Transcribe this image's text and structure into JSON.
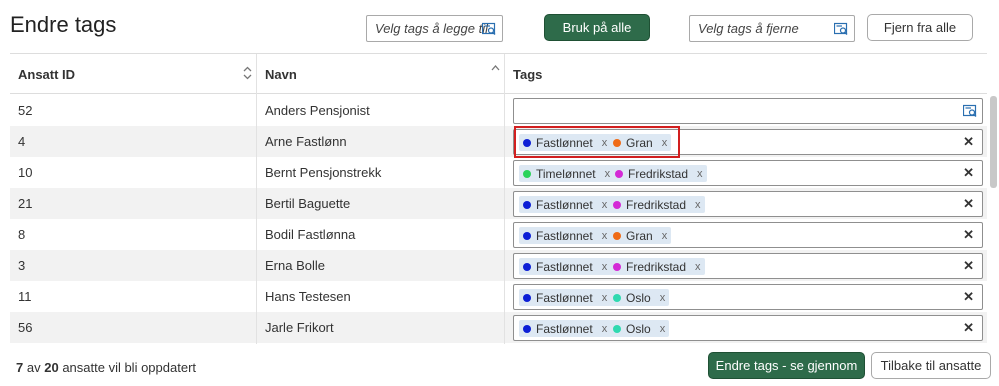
{
  "page": {
    "title": "Endre tags"
  },
  "toolbar": {
    "add_placeholder": "Velg tags å legge til",
    "apply_all": "Bruk på alle",
    "remove_placeholder": "Velg tags å fjerne",
    "remove_all": "Fjern fra alle"
  },
  "table": {
    "columns": {
      "id": "Ansatt ID",
      "name": "Navn",
      "tags": "Tags"
    },
    "rows": [
      {
        "id": "52",
        "name": "Anders Pensjonist",
        "tags": []
      },
      {
        "id": "4",
        "name": "Arne Fastlønn",
        "tags": [
          {
            "label": "Fastlønnet",
            "color": "#0d1fd6"
          },
          {
            "label": "Gran",
            "color": "#ef6b17"
          }
        ]
      },
      {
        "id": "10",
        "name": "Bernt Pensjonstrekk",
        "tags": [
          {
            "label": "Timelønnet",
            "color": "#2bd35a"
          },
          {
            "label": "Fredrikstad",
            "color": "#d42ad6"
          }
        ]
      },
      {
        "id": "21",
        "name": "Bertil Baguette",
        "tags": [
          {
            "label": "Fastlønnet",
            "color": "#0d1fd6"
          },
          {
            "label": "Fredrikstad",
            "color": "#d42ad6"
          }
        ]
      },
      {
        "id": "8",
        "name": "Bodil Fastlønna",
        "tags": [
          {
            "label": "Fastlønnet",
            "color": "#0d1fd6"
          },
          {
            "label": "Gran",
            "color": "#ef6b17"
          }
        ]
      },
      {
        "id": "3",
        "name": "Erna Bolle",
        "tags": [
          {
            "label": "Fastlønnet",
            "color": "#0d1fd6"
          },
          {
            "label": "Fredrikstad",
            "color": "#d42ad6"
          }
        ]
      },
      {
        "id": "11",
        "name": "Hans Testesen",
        "tags": [
          {
            "label": "Fastlønnet",
            "color": "#0d1fd6"
          },
          {
            "label": "Oslo",
            "color": "#2fd9b0"
          }
        ]
      },
      {
        "id": "56",
        "name": "Jarle Frikort",
        "tags": [
          {
            "label": "Fastlønnet",
            "color": "#0d1fd6"
          },
          {
            "label": "Oslo",
            "color": "#2fd9b0"
          }
        ]
      }
    ]
  },
  "footer": {
    "count": "7",
    "of": "av",
    "total": "20",
    "suffix": "ansatte vil bli oppdatert",
    "review_button": "Endre tags - se gjennom",
    "back_button": "Tilbake til ansatte"
  },
  "colors": {
    "primary": "#2e6b4a",
    "highlight": "#d21f1f",
    "chip_bg": "#dde8f3"
  },
  "icons": {
    "tag_picker": "search-list-icon",
    "clear": "close-icon",
    "sort": "sort-icon"
  }
}
